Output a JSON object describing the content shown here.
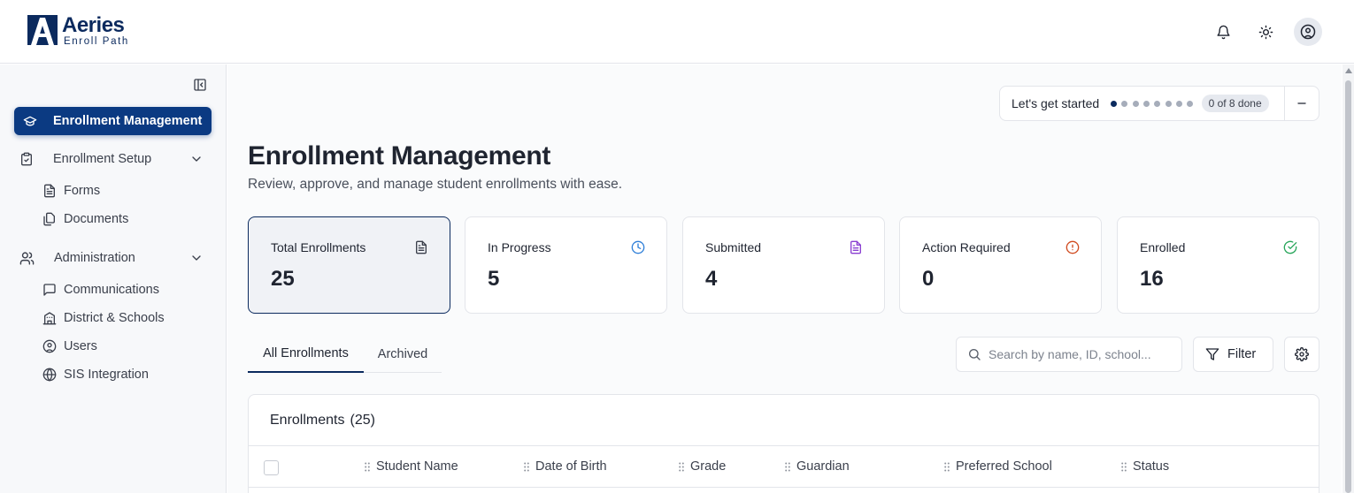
{
  "brand": {
    "name": "Aeries",
    "subtitle": "Enroll Path"
  },
  "sidebar": {
    "active": {
      "label": "Enrollment Management"
    },
    "groups": [
      {
        "label": "Enrollment Setup",
        "items": [
          "Forms",
          "Documents"
        ]
      },
      {
        "label": "Administration",
        "items": [
          "Communications",
          "District & Schools",
          "Users",
          "SIS Integration"
        ]
      }
    ]
  },
  "getstarted": {
    "label": "Let's get started",
    "steps_total": 8,
    "steps_done": 0,
    "badge": "0 of 8 done"
  },
  "page": {
    "title": "Enrollment Management",
    "subtitle": "Review, approve, and manage student enrollments with ease."
  },
  "cards": [
    {
      "label": "Total Enrollments",
      "value": "25",
      "icon": "document-icon",
      "color": "#3a3f4b"
    },
    {
      "label": "In Progress",
      "value": "5",
      "icon": "clock-icon",
      "color": "#2f7fd8"
    },
    {
      "label": "Submitted",
      "value": "4",
      "icon": "document-icon",
      "color": "#8a3fd1"
    },
    {
      "label": "Action Required",
      "value": "0",
      "icon": "alert-circle-icon",
      "color": "#d04a1f"
    },
    {
      "label": "Enrolled",
      "value": "16",
      "icon": "check-circle-icon",
      "color": "#27a55a"
    }
  ],
  "tabs": [
    "All Enrollments",
    "Archived"
  ],
  "toolbar": {
    "search_placeholder": "Search by name, ID, school...",
    "filter_label": "Filter"
  },
  "table": {
    "title": "Enrollments",
    "count": "(25)",
    "columns": [
      "Student Name",
      "Date of Birth",
      "Grade",
      "Guardian",
      "Preferred School",
      "Status"
    ]
  }
}
